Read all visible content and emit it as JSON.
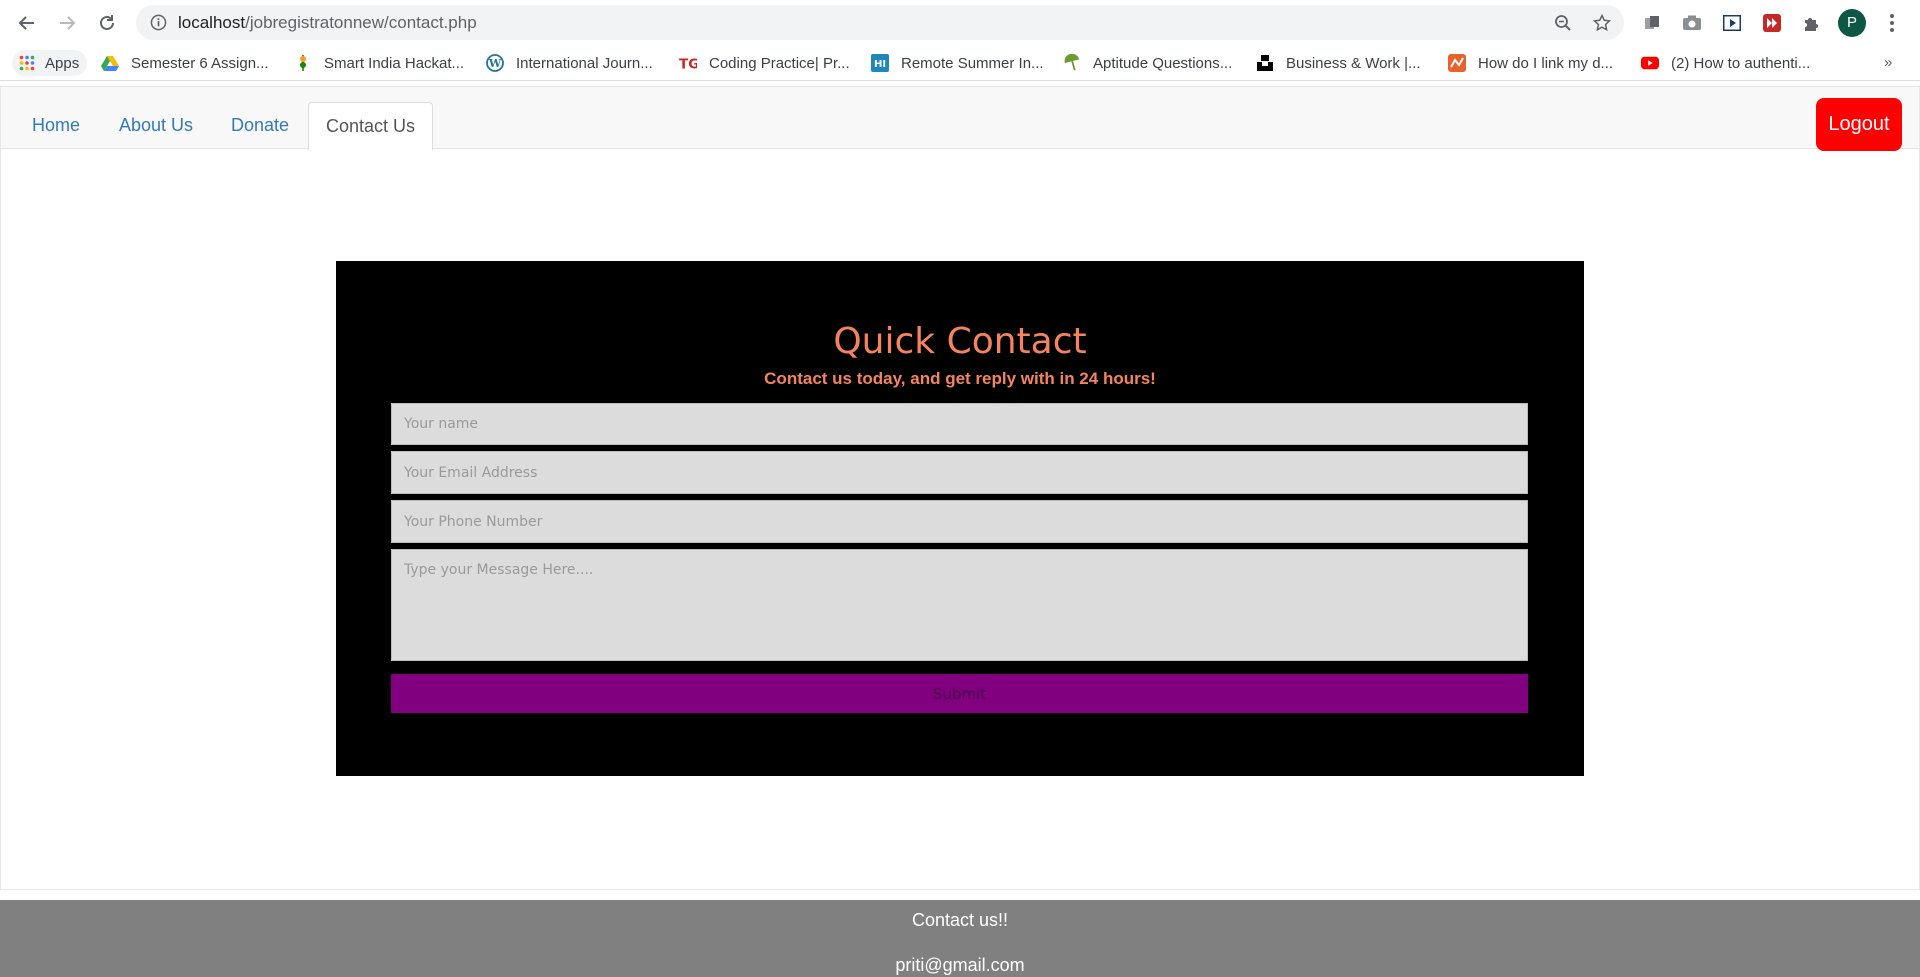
{
  "browser": {
    "url_host": "localhost",
    "url_path": "/jobregistratonnew/contact.php",
    "profile_initial": "P",
    "bookmarks": [
      {
        "label": "Apps",
        "icon": "apps-grid-icon"
      },
      {
        "label": "Semester 6 Assign...",
        "icon": "google-drive-icon"
      },
      {
        "label": "Smart India Hackat...",
        "icon": "sih-logo-icon"
      },
      {
        "label": "International Journ...",
        "icon": "wordpress-icon"
      },
      {
        "label": "Coding Practice| Pr...",
        "icon": "tg-logo-icon"
      },
      {
        "label": "Remote Summer In...",
        "icon": "hi-logo-icon"
      },
      {
        "label": "Aptitude Questions...",
        "icon": "umbrella-icon"
      },
      {
        "label": "Business & Work |...",
        "icon": "unsplash-icon"
      },
      {
        "label": "How do I link my d...",
        "icon": "zoho-icon"
      },
      {
        "label": "(2) How to authenti...",
        "icon": "youtube-icon"
      }
    ],
    "more_bookmarks": "»"
  },
  "nav": {
    "home": "Home",
    "about": "About Us",
    "donate": "Donate",
    "contact": "Contact Us",
    "logout": "Logout"
  },
  "contact": {
    "title": "Quick Contact",
    "subtitle": "Contact us today, and get reply with in 24 hours!",
    "name_placeholder": "Your name",
    "email_placeholder": "Your Email Address",
    "phone_placeholder": "Your Phone Number",
    "message_placeholder": "Type your Message Here....",
    "submit": "Submit"
  },
  "footer": {
    "line1": "Contact us!!",
    "line2": "priti@gmail.com"
  },
  "colors": {
    "accent": "#f4845f",
    "submit_bg": "#800080",
    "logout_bg": "#ff0000",
    "link": "#337ab7",
    "footer_bg": "#808080"
  }
}
